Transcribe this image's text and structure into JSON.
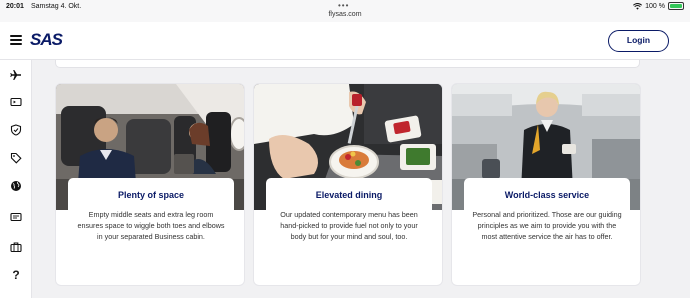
{
  "status_bar": {
    "time": "20:01",
    "date": "Samstag 4. Okt.",
    "url": "flysas.com",
    "battery_label": "100 %",
    "battery_level": 1.0
  },
  "header": {
    "logo": "SAS",
    "login_label": "Login"
  },
  "rail": {
    "items": [
      "menu-icon",
      "airplane-icon",
      "boarding-pass-icon",
      "shield-check-icon",
      "tag-icon",
      "globe-icon",
      "id-card-icon",
      "briefcase-icon",
      "help-icon"
    ],
    "help_label": "?"
  },
  "cards": [
    {
      "title": "Plenty of space",
      "text": "Empty middle seats and extra leg room ensures space to wiggle both toes and elbows in your separated Business cabin."
    },
    {
      "title": "Elevated dining",
      "text": "Our updated contemporary menu has been hand-picked to provide fuel not only to your body but for your mind and soul, too."
    },
    {
      "title": "World-class service",
      "text": "Personal and prioritized. Those are our guiding principles as we aim to provide you with the most attentive service the air has to offer."
    }
  ],
  "colors": {
    "brand": "#0a1a66",
    "background": "#f1f1f3",
    "battery": "#34c759"
  }
}
